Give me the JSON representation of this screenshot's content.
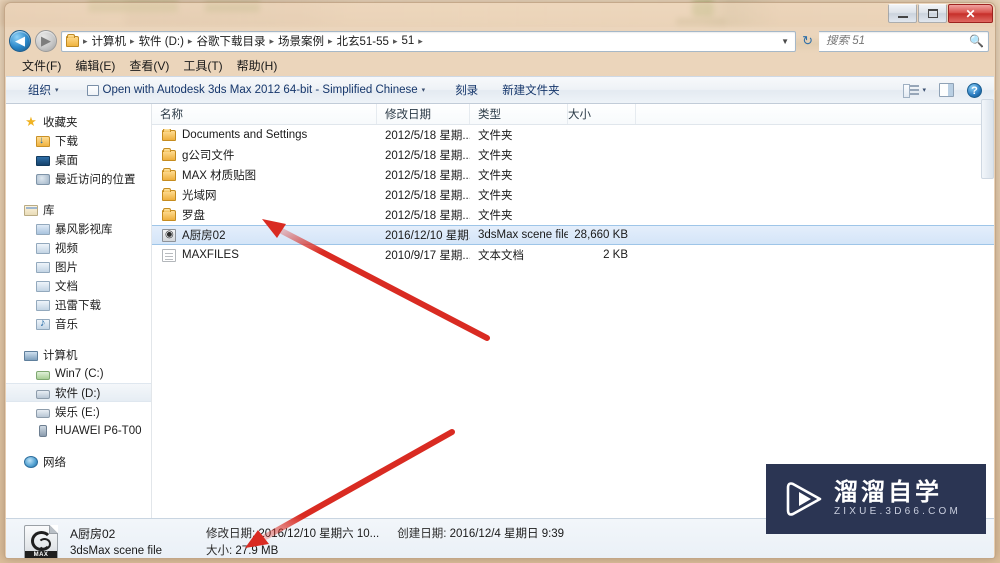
{
  "window": {
    "controls": {
      "minimize": "minimize",
      "maximize": "maximize",
      "close": "✕"
    }
  },
  "address": {
    "back_icon": "◀",
    "forward_icon": "▶",
    "breadcrumbs": [
      "计算机",
      "软件 (D:)",
      "谷歌下载目录",
      "场景案例",
      "北玄51-55",
      "51"
    ],
    "separator": "▸",
    "dropdown_icon": "▼",
    "refresh_icon": "↻"
  },
  "search": {
    "placeholder": "搜索 51",
    "icon": "search-icon"
  },
  "menubar": {
    "items": [
      "文件(F)",
      "编辑(E)",
      "查看(V)",
      "工具(T)",
      "帮助(H)"
    ]
  },
  "toolbar": {
    "organize": "组织",
    "open_with": "Open with Autodesk 3ds Max 2012 64-bit - Simplified Chinese",
    "burn": "刻录",
    "new_folder": "新建文件夹",
    "caret": "▾",
    "help_glyph": "?"
  },
  "navpane": {
    "favorites": {
      "title": "收藏夹",
      "items": [
        "下载",
        "桌面",
        "最近访问的位置"
      ]
    },
    "libraries": {
      "title": "库",
      "items": [
        "暴风影视库",
        "视频",
        "图片",
        "文档",
        "迅雷下载",
        "音乐"
      ]
    },
    "computer": {
      "title": "计算机",
      "items": [
        "Win7 (C:)",
        "软件 (D:)",
        "娱乐 (E:)",
        "HUAWEI P6-T00"
      ],
      "selected": "软件 (D:)"
    },
    "network": {
      "title": "网络"
    }
  },
  "filelist": {
    "columns": [
      "名称",
      "修改日期",
      "类型",
      "大小"
    ],
    "rows": [
      {
        "name": "Documents and Settings",
        "date": "2012/5/18 星期...",
        "type": "文件夹",
        "size": "",
        "icon": "folder",
        "selected": false
      },
      {
        "name": "g公司文件",
        "date": "2012/5/18 星期...",
        "type": "文件夹",
        "size": "",
        "icon": "folder",
        "selected": false
      },
      {
        "name": "MAX 材质贴图",
        "date": "2012/5/18 星期...",
        "type": "文件夹",
        "size": "",
        "icon": "folder",
        "selected": false
      },
      {
        "name": "光域网",
        "date": "2012/5/18 星期...",
        "type": "文件夹",
        "size": "",
        "icon": "folder",
        "selected": false
      },
      {
        "name": "罗盘",
        "date": "2012/5/18 星期...",
        "type": "文件夹",
        "size": "",
        "icon": "folder",
        "selected": false
      },
      {
        "name": "A厨房02",
        "date": "2016/12/10 星期...",
        "type": "3dsMax scene file",
        "size": "28,660 KB",
        "icon": "max",
        "selected": true
      },
      {
        "name": "MAXFILES",
        "date": "2010/9/17 星期...",
        "type": "文本文档",
        "size": "2 KB",
        "icon": "txt",
        "selected": false
      }
    ]
  },
  "details": {
    "file_name": "A厨房02",
    "file_type": "3dsMax scene file",
    "modified_label": "修改日期:",
    "modified_value": "2016/12/10 星期六 10...",
    "created_label": "创建日期:",
    "created_value": "2016/12/4 星期日 9:39",
    "size_label": "大小:",
    "size_value": "27.9 MB",
    "icon_label": "MAX"
  },
  "watermark": {
    "cn": "溜溜自学",
    "en": "ZIXUE.3D66.COM",
    "bg": "#2b3553"
  },
  "annotations": {
    "arrow_color": "#d92b22",
    "arrow1": "points-to-selected-file-row",
    "arrow2": "points-to-details-size"
  }
}
